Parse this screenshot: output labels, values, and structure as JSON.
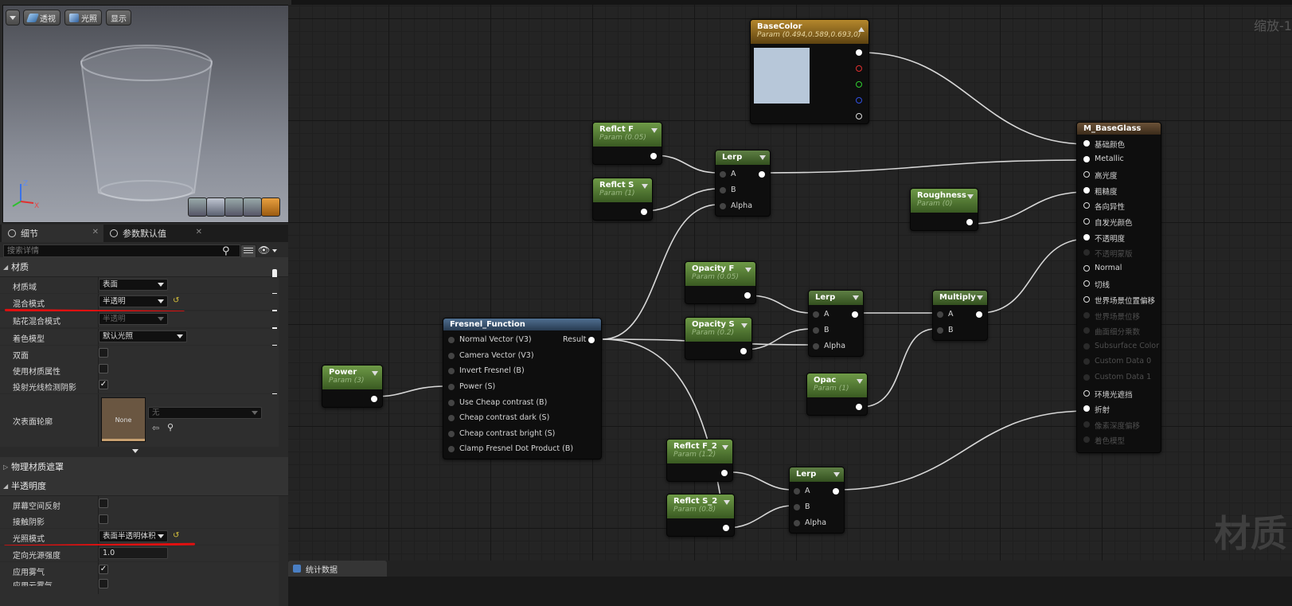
{
  "viewport": {
    "toolbar": {
      "menu_label": "",
      "perspective": "透视",
      "lit": "光照",
      "show": "显示"
    },
    "axis": {
      "x": "X",
      "z": "Z"
    }
  },
  "tabs": [
    {
      "label": "细节",
      "icon": "details-icon"
    },
    {
      "label": "参数默认值",
      "icon": "params-icon"
    }
  ],
  "search": {
    "placeholder": "搜索详情"
  },
  "sections": {
    "material": "材质",
    "physical": "物理材质遮罩",
    "translucency": "半透明度"
  },
  "material_props": [
    {
      "label": "材质域",
      "value": "表面"
    },
    {
      "label": "混合模式",
      "value": "半透明"
    },
    {
      "label": "贴花混合模式",
      "value": "半透明"
    },
    {
      "label": "着色模型",
      "value": "默认光照"
    },
    {
      "label": "双面",
      "checked": false
    },
    {
      "label": "使用材质属性",
      "checked": false
    },
    {
      "label": "投射光线检测阴影",
      "checked": true
    },
    {
      "label": "次表面轮廓",
      "thumbnail": "None",
      "value": "无"
    }
  ],
  "translucency_props": [
    {
      "label": "屏幕空间反射",
      "checked": false
    },
    {
      "label": "接触阴影",
      "checked": false
    },
    {
      "label": "光照模式",
      "value": "表面半透明体积"
    },
    {
      "label": "定向光源强度",
      "value": "1.0"
    },
    {
      "label": "应用雾气",
      "checked": true
    },
    {
      "label": "应用云雾气",
      "checked": false
    }
  ],
  "graph": {
    "zoom": "缩放-1",
    "watermark": "材质",
    "nodes": {
      "basecolor": {
        "title": "BaseColor",
        "sub": "Param (0.494,0.589,0.693,0)",
        "swatch": "#b7c7d9"
      },
      "reflct_f": {
        "title": "Reflct F",
        "sub": "Param (0.05)"
      },
      "reflct_s": {
        "title": "Reflct S",
        "sub": "Param (1)"
      },
      "lerp1": {
        "title": "Lerp",
        "a": "A",
        "b": "B",
        "alpha": "Alpha"
      },
      "roughness": {
        "title": "Roughness",
        "sub": "Param (0)"
      },
      "opacity_f": {
        "title": "Opacity F",
        "sub": "Param (0.05)"
      },
      "opacity_s": {
        "title": "Opacity S",
        "sub": "Param (0.2)"
      },
      "lerp2": {
        "title": "Lerp",
        "a": "A",
        "b": "B",
        "alpha": "Alpha"
      },
      "multiply": {
        "title": "Multiply",
        "a": "A",
        "b": "B"
      },
      "opac": {
        "title": "Opac",
        "sub": "Param (1)"
      },
      "power": {
        "title": "Power",
        "sub": "Param (3)"
      },
      "fresnel": {
        "title": "Fresnel_Function",
        "result": "Result",
        "inputs": [
          "Normal Vector (V3)",
          "Camera Vector (V3)",
          "Invert Fresnel (B)",
          "Power (S)",
          "Use Cheap contrast (B)",
          "Cheap contrast dark (S)",
          "Cheap contrast bright (S)",
          "Clamp Fresnel Dot Product (B)"
        ]
      },
      "reflct_f2": {
        "title": "Reflct F_2",
        "sub": "Param (1.2)"
      },
      "reflct_s2": {
        "title": "Reflct S_2",
        "sub": "Param (0.8)"
      },
      "lerp3": {
        "title": "Lerp",
        "a": "A",
        "b": "B",
        "alpha": "Alpha"
      },
      "result": {
        "title": "M_BaseGlass",
        "pins": [
          "基础颜色",
          "Metallic",
          "高光度",
          "粗糙度",
          "各向异性",
          "自发光颜色",
          "不透明度",
          "不透明蒙版",
          "Normal",
          "切线",
          "世界场景位置偏移",
          "世界场景位移",
          "曲面细分乘数",
          "Subsurface Color",
          "Custom Data 0",
          "Custom Data 1",
          "环境光遮挡",
          "折射",
          "像素深度偏移",
          "着色模型"
        ]
      }
    }
  },
  "bottom": {
    "stats_tab": "统计数据"
  },
  "colors": {
    "accent_red": "#e01010",
    "param_green": "#5a8a36",
    "param_gold": "#a07a2a",
    "function_blue": "#3d5a7a"
  }
}
